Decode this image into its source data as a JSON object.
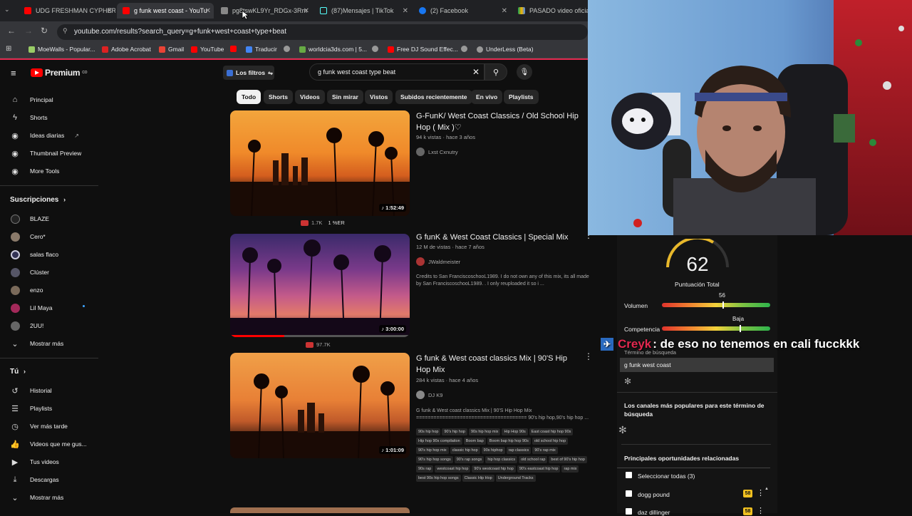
{
  "browser": {
    "tabs": [
      {
        "title": "UDG FRESHMAN CYPHER"
      },
      {
        "title": "g funk west coast - YouTu"
      },
      {
        "title": "pg8tswKL9Yr_RDGx-3Rm"
      },
      {
        "title": "(87)Mensajes | TikTok"
      },
      {
        "title": "(2) Facebook"
      },
      {
        "title": "PASADO video oficial.m"
      }
    ],
    "url": "youtube.com/results?search_query=g+funk+west+coast+type+beat",
    "bookmarks": [
      "MoeWalls - Popular...",
      "Adobe Acrobat",
      "Gmail",
      "YouTube",
      "Traducir",
      "worldcia3ds.com | 5...",
      "Free DJ Sound Effec...",
      "UnderLess (Beta)"
    ]
  },
  "header": {
    "logo": "Premium",
    "logo_sup": "CO",
    "filters_label": "Los filtros",
    "search_value": "g funk west coast type beat"
  },
  "chips": [
    "Todo",
    "Shorts",
    "Videos",
    "Sin mirar",
    "Vistos",
    "Subidos recientemente",
    "En vivo",
    "Playlists"
  ],
  "sidebar": {
    "nav": [
      "Principal",
      "Shorts",
      "Ideas diarias",
      "Thumbnail Preview",
      "More Tools"
    ],
    "subs_title": "Suscripciones",
    "subs": [
      "BLAZE",
      "Cero*",
      "salas flaco",
      "Clúster",
      "enzo",
      "Lil Maya",
      "2UU!"
    ],
    "show_more": "Mostrar más",
    "you_title": "Tú",
    "you": [
      "Historial",
      "Playlists",
      "Ver más tarde",
      "Videos que me gus...",
      "Tus videos",
      "Descargas"
    ],
    "show_more2": "Mostrar más"
  },
  "results": [
    {
      "title": "G-FunK/ West Coast Classics / Old School Hip Hop ( Mix )♡",
      "meta": "94 k vistas · hace 3 años",
      "channel": "Lxst Cxnutry",
      "duration": "1:52:49",
      "likes": "1.7K",
      "ratio": "1 %ER"
    },
    {
      "title": "G funK & West Coast Classics | Special Mix",
      "meta": "12 M de vistas · hace 7 años",
      "channel": "JWaldmeister",
      "desc": "Credits to San FranciscoschooL1989. I do not own any of this mix, its all made by San FranciscoschooL1989. . I only reuploaded it so i ...",
      "duration": "3:00:00",
      "likes": "97.7K"
    },
    {
      "title": "G funk & West coast classics Mix | 90'S Hip Hop Mix",
      "meta": "284 k vistas · hace 4 años",
      "channel": "DJ K9",
      "desc": "G funk & West coast classics Mix | 90'S Hip Hop Mix",
      "desc2": "====================================== 90's hip hop,90's hip hop ...",
      "duration": "1:01:09",
      "tags": [
        "90s hip hop",
        "90's hip hop",
        "90s hip hop mix",
        "Hip Hop 90s",
        "East coast hip hop 90s",
        "Hip hop 90s compilation",
        "Boom bap",
        "Boom bap hip hop 90s",
        "old school hip hop",
        "90's hip hop mix",
        "classic hip hop",
        "90s hiphop",
        "rap classics",
        "90's rap mix",
        "90's hip hop songs",
        "90's rap songs",
        "hip hop classics",
        "old school rap",
        "best of 90's hip hop",
        "90s rap",
        "westcoast hip hop",
        "90's westcoast hip hop",
        "90's eastcoast hip hop",
        "rap mix",
        "best 90s hip hop songs",
        "Classic Hip Hop",
        "Underground Tracks"
      ]
    }
  ],
  "panel": {
    "score": "62",
    "score_label": "Puntuación Total",
    "volume_label": "Volumen",
    "volume_value": "56",
    "volume_level": 0.56,
    "competition_label": "Competencia",
    "competition_value": "Baja",
    "competition_level": 0.72,
    "term_label": "Término de búsqueda",
    "term_value": "g funk west coast",
    "channels_title": "Los canales más populares para este término de búsqueda",
    "opps_title": "Principales oportunidades relacionadas",
    "select_all": "Seleccionar todas (3)",
    "items": [
      {
        "label": "dogg pound",
        "score": "58"
      },
      {
        "label": "daz dillinger",
        "score": "58"
      }
    ]
  },
  "overlay": {
    "name": "Creyk",
    "message": ": de eso no tenemos en cali fucckkk"
  },
  "colors": {
    "accent": "#ff0000",
    "name": "#e3284f",
    "bg": "#0f0f0f"
  }
}
